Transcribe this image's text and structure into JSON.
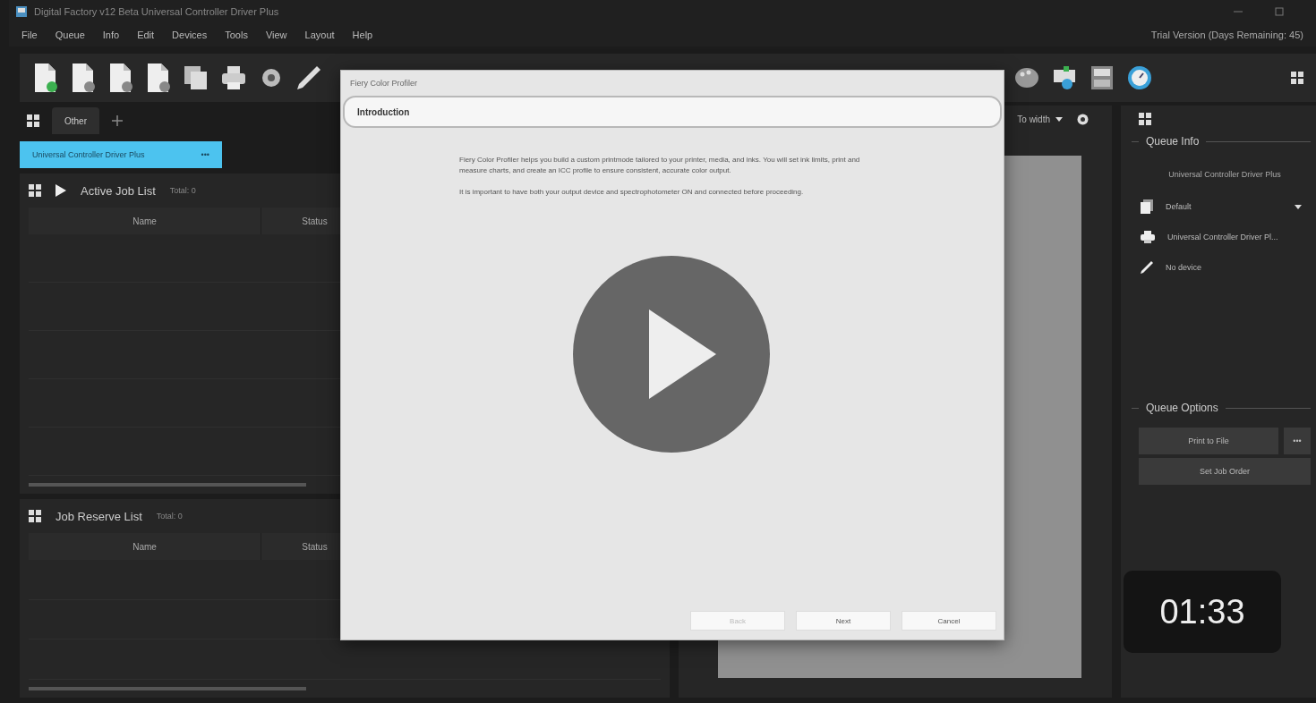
{
  "window": {
    "title": "Digital Factory v12 Beta Universal Controller Driver Plus",
    "trial_notice": "Trial Version (Days Remaining: 45)"
  },
  "menu": [
    "File",
    "Queue",
    "Info",
    "Edit",
    "Devices",
    "Tools",
    "View",
    "Layout",
    "Help"
  ],
  "left_panel": {
    "tabs": [
      {
        "label": "Other",
        "selected": true
      }
    ],
    "driver": {
      "label": "Universal Controller Driver Plus",
      "more": "•••"
    },
    "active_job_list": {
      "title": "Active Job List",
      "total": "Total: 0",
      "columns": [
        "Name",
        "Status"
      ]
    },
    "job_reserve_list": {
      "title": "Job Reserve List",
      "total": "Total: 0",
      "columns": [
        "Name",
        "Status"
      ]
    }
  },
  "preview": {
    "zoom": "To width"
  },
  "queue_info": {
    "title": "Queue Info",
    "queue_name": "Universal Controller Driver Plus",
    "rows": [
      {
        "kind": "preset",
        "label": "Default",
        "dropdown": true
      },
      {
        "kind": "printer",
        "label": "Universal Controller Driver Pl...",
        "dropdown": false
      },
      {
        "kind": "device",
        "label": "No device",
        "dropdown": false
      }
    ]
  },
  "queue_options": {
    "title": "Queue Options",
    "print_to_file": "Print to File",
    "more": "•••",
    "set_job_order": "Set Job Order"
  },
  "dialog": {
    "title": "Fiery Color Profiler",
    "step": "Introduction",
    "paragraphs": [
      "Fiery Color Profiler helps you build a custom printmode tailored to your printer, media, and inks. You will set ink limits, print and measure charts, and create an ICC profile to ensure consistent, accurate color output.",
      "It is important to have both your output device and spectrophotometer ON and connected before proceeding."
    ],
    "buttons": [
      {
        "label": "Back",
        "disabled": true
      },
      {
        "label": "Next",
        "disabled": false
      },
      {
        "label": "Cancel",
        "disabled": false
      }
    ]
  },
  "video": {
    "timer": "01:33"
  }
}
